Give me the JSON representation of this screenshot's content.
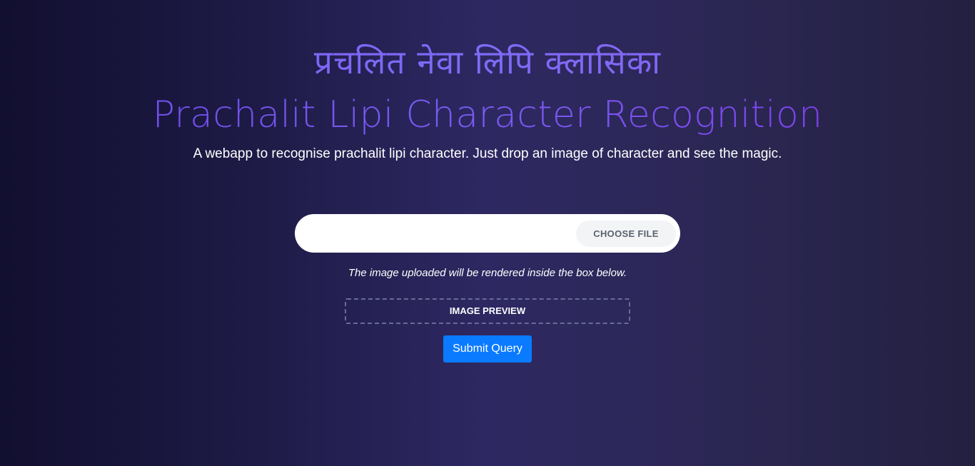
{
  "header": {
    "native_title": "प्रचलित नेवा लिपि क्लासिका",
    "title": "Prachalit Lipi Character Recognition",
    "subtitle": "A webapp to recognise prachalit lipi character. Just drop an image of character and see the magic."
  },
  "upload": {
    "file_value": "",
    "choose_file_label": "CHOOSE FILE",
    "hint": "The image uploaded will be rendered inside the box below."
  },
  "preview": {
    "label": "IMAGE PREVIEW"
  },
  "form": {
    "submit_label": "Submit Query"
  },
  "colors": {
    "accent": "#0a7bff",
    "title_gradient_start": "#6b49e6",
    "title_gradient_end": "#7e35e8",
    "background_dark": "#120f30",
    "background_mid": "#2e2862"
  }
}
